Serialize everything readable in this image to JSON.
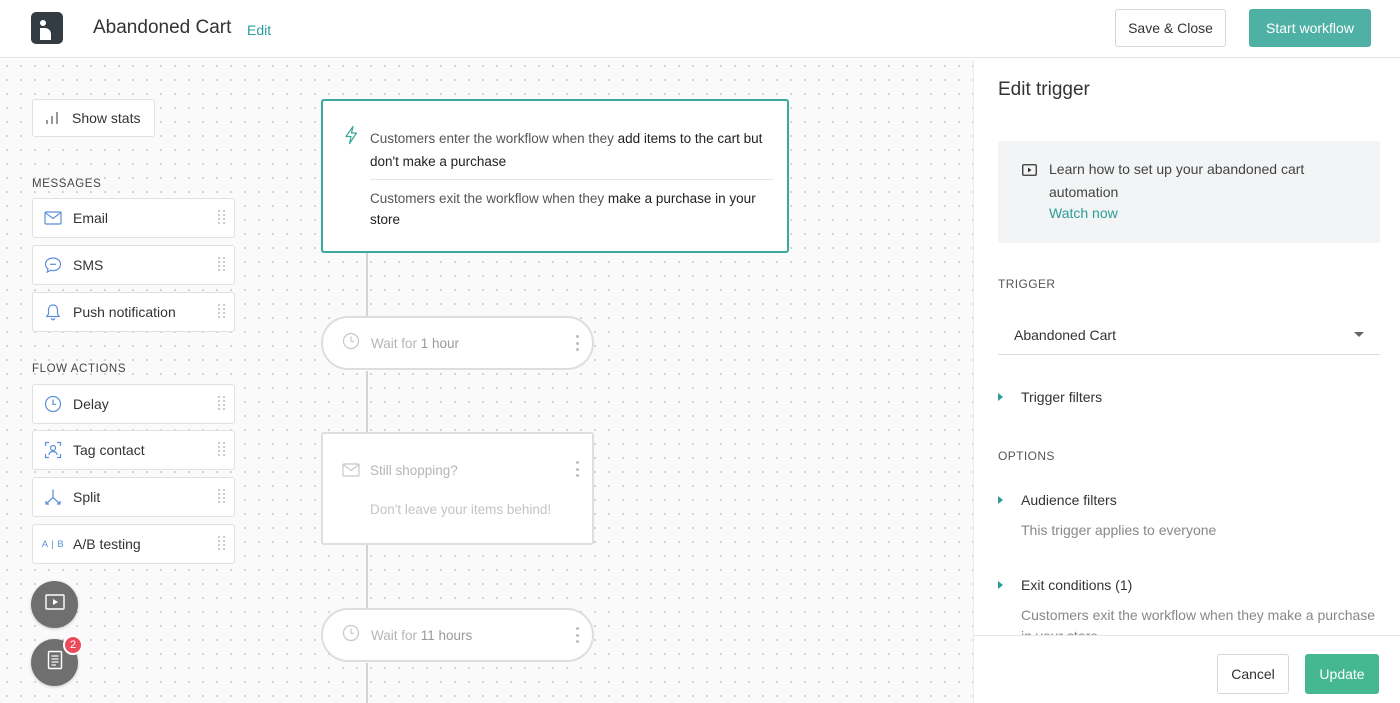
{
  "header": {
    "title": "Abandoned Cart",
    "edit_label": "Edit",
    "save_close_label": "Save & Close",
    "start_label": "Start workflow"
  },
  "sidebar": {
    "show_stats_label": "Show stats",
    "messages_heading": "MESSAGES",
    "messages": [
      {
        "label": "Email",
        "icon": "mail-icon"
      },
      {
        "label": "SMS",
        "icon": "chat-bubble-icon"
      },
      {
        "label": "Push notification",
        "icon": "bell-icon"
      }
    ],
    "actions_heading": "FLOW ACTIONS",
    "actions": [
      {
        "label": "Delay",
        "icon": "clock-icon"
      },
      {
        "label": "Tag contact",
        "icon": "tag-contact-icon"
      },
      {
        "label": "Split",
        "icon": "split-icon"
      },
      {
        "label": "A/B testing",
        "icon": "ab-test-icon",
        "icon_text": "A | B"
      }
    ],
    "notification_count": "2"
  },
  "workflow": {
    "trigger": {
      "enter_prefix": "Customers enter the workflow when they ",
      "enter_bold": "add items to the cart but don't make a purchase",
      "exit_prefix": "Customers exit the workflow when they ",
      "exit_bold": "make a purchase in your store"
    },
    "wait1": {
      "prefix": "Wait for ",
      "value": "1 hour"
    },
    "email": {
      "title": "Still shopping?",
      "subtitle": "Don't leave your items behind!"
    },
    "wait2": {
      "prefix": "Wait for ",
      "value": "11 hours"
    }
  },
  "panel": {
    "title": "Edit trigger",
    "info_text": "Learn how to set up your abandoned cart automation",
    "watch_label": "Watch now",
    "trigger_heading": "TRIGGER",
    "trigger_value": "Abandoned Cart",
    "trigger_filters_label": "Trigger filters",
    "options_heading": "OPTIONS",
    "audience_label": "Audience filters",
    "audience_desc": "This trigger applies to everyone",
    "exit_label": "Exit conditions (1)",
    "exit_desc": "Customers exit the workflow when they make a purchase in your store",
    "cancel_label": "Cancel",
    "update_label": "Update"
  },
  "colors": {
    "accent": "#3aa89e",
    "start_button": "#4fb1a5",
    "update_button": "#45b892",
    "badge": "#e94b5a"
  }
}
